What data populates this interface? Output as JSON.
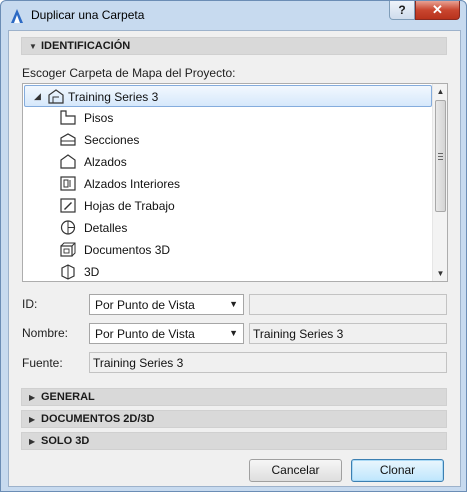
{
  "window": {
    "title": "Duplicar una Carpeta",
    "help_label": "?",
    "close_label": "✕"
  },
  "identification": {
    "header": "IDENTIFICACIÓN",
    "tree_caption": "Escoger Carpeta de Mapa del Proyecto:",
    "tree": {
      "root": {
        "label": "Training Series 3",
        "icon": "project-icon",
        "selected": true
      },
      "items": [
        {
          "label": "Pisos",
          "icon": "stories-icon"
        },
        {
          "label": "Secciones",
          "icon": "sections-icon"
        },
        {
          "label": "Alzados",
          "icon": "elevations-icon"
        },
        {
          "label": "Alzados Interiores",
          "icon": "interior-elevations-icon"
        },
        {
          "label": "Hojas de Trabajo",
          "icon": "worksheets-icon"
        },
        {
          "label": "Detalles",
          "icon": "details-icon"
        },
        {
          "label": "Documentos 3D",
          "icon": "3d-documents-icon"
        },
        {
          "label": "3D",
          "icon": "3d-icon"
        }
      ]
    },
    "id_field": {
      "label": "ID:",
      "select_value": "Por Punto de Vista",
      "text_value": ""
    },
    "name_field": {
      "label": "Nombre:",
      "select_value": "Por Punto de Vista",
      "text_value": "Training Series 3"
    },
    "source_field": {
      "label": "Fuente:",
      "value": "Training Series 3"
    }
  },
  "sections": {
    "general": "GENERAL",
    "documents": "DOCUMENTOS 2D/3D",
    "only3d": "SOLO 3D"
  },
  "buttons": {
    "cancel": "Cancelar",
    "clone": "Clonar"
  },
  "colors": {
    "title_bar": "#c7daef",
    "close_button": "#c9462f",
    "selection": "#d6e8fb",
    "primary_button": "#bee6fd"
  }
}
